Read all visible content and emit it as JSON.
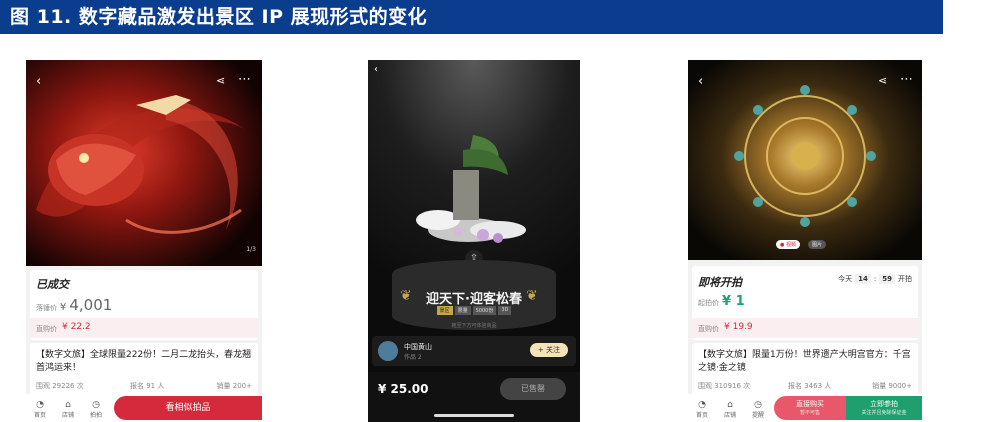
{
  "figure_title": "图 11. 数字藏品激发出景区 IP 展现形式的变化",
  "phones": {
    "left": {
      "image_index": "1/3",
      "status": "已成交",
      "price_label": "落锤价",
      "price_currency": "¥",
      "price_value": "4,001",
      "direct_label": "直购价",
      "direct_price": "¥ 22.2",
      "desc": "【数字文旅】全球限量222份！二月二龙抬头，春龙翘首鸿运来！",
      "stat1": "围观 29226 次",
      "stat2": "报名 91 人",
      "stat3": "销量 200+",
      "nav": [
        "首页",
        "店铺",
        "拍拍"
      ],
      "cta": "看相似拍品"
    },
    "middle": {
      "title": "迎天下·迎客松春",
      "tags": [
        "景区",
        "限量",
        "5000份",
        "3D"
      ],
      "hint": "拖至下方可体验商品",
      "creator_name": "中国黄山",
      "creator_works": "作品 2",
      "follow": "+ 关注",
      "price": "¥ 25.00",
      "sold": "已售罄"
    },
    "right": {
      "pill1": "● 视频",
      "pill2": "图片",
      "status": "即将开拍",
      "time_prefix": "今天",
      "time_h": "14",
      "time_m": "59",
      "time_suffix": "开拍",
      "start_label": "起拍价",
      "start_price": "¥ 1",
      "direct_label": "直购价",
      "direct_price": "¥ 19.9",
      "desc": "【数字文旅】限量1万份！世界遗产大明宫官方：千宫之镜·金之镜",
      "stat1": "围观 310916 次",
      "stat2": "报名 3463 人",
      "stat3": "销量 9000+",
      "nav": [
        "首页",
        "店铺",
        "提醒"
      ],
      "cta1": "直接购买",
      "cta1_sub": "暂不可售",
      "cta2": "立即参拍",
      "cta2_sub": "关注并且免除保证金"
    }
  }
}
